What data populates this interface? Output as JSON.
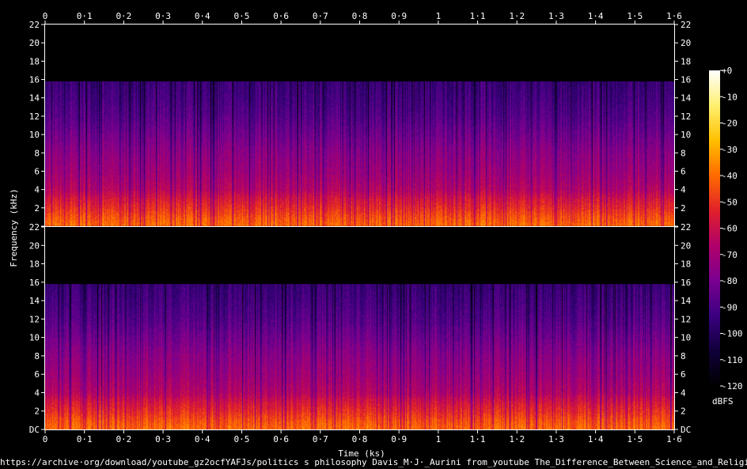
{
  "chart_data": {
    "type": "heatmap",
    "title": "",
    "xlabel": "Time (ks)",
    "ylabel": "Frequency (kHz)",
    "x_ticks": [
      "0",
      "0·1",
      "0·2",
      "0·3",
      "0·4",
      "0·5",
      "0·6",
      "0·7",
      "0·8",
      "0·9",
      "1",
      "1·1",
      "1·2",
      "1·3",
      "1·4",
      "1·5",
      "1·6"
    ],
    "y_ticks": [
      "2",
      "4",
      "6",
      "8",
      "10",
      "12",
      "14",
      "16",
      "18",
      "20",
      "22"
    ],
    "y_bottom_label": "DC",
    "xlim": [
      0,
      1.6
    ],
    "ylim_khz": [
      0,
      22
    ],
    "content_cutoff_khz": 15.8,
    "channels": [
      "channel-1",
      "channel-2"
    ],
    "colorbar": {
      "label": "dBFS",
      "ticks": [
        "+0",
        "-10",
        "-20",
        "-30",
        "-40",
        "-50",
        "-60",
        "-70",
        "-80",
        "-90",
        "-100",
        "-110",
        "-120"
      ],
      "range_dbfs": [
        -120,
        0
      ],
      "colors": [
        "#000000",
        "#10003a",
        "#3a0080",
        "#7a0090",
        "#b0006a",
        "#e0202a",
        "#ff6a00",
        "#ffc000",
        "#fff070",
        "#ffffff"
      ]
    },
    "energy_profile": [
      {
        "khz": 0,
        "dbfs": -40
      },
      {
        "khz": 1,
        "dbfs": -45
      },
      {
        "khz": 2,
        "dbfs": -52
      },
      {
        "khz": 3,
        "dbfs": -58
      },
      {
        "khz": 4,
        "dbfs": -66
      },
      {
        "khz": 6,
        "dbfs": -72
      },
      {
        "khz": 8,
        "dbfs": -76
      },
      {
        "khz": 10,
        "dbfs": -82
      },
      {
        "khz": 12,
        "dbfs": -88
      },
      {
        "khz": 14,
        "dbfs": -92
      },
      {
        "khz": 15.8,
        "dbfs": -95
      }
    ]
  },
  "source_url": "https://archive·org/download/youtube_gz2ocfYAFJs/politics s philosophy Davis_M·J·_Aurini from_youtube The_Difference_Between_Science_and_Religion·mp3"
}
